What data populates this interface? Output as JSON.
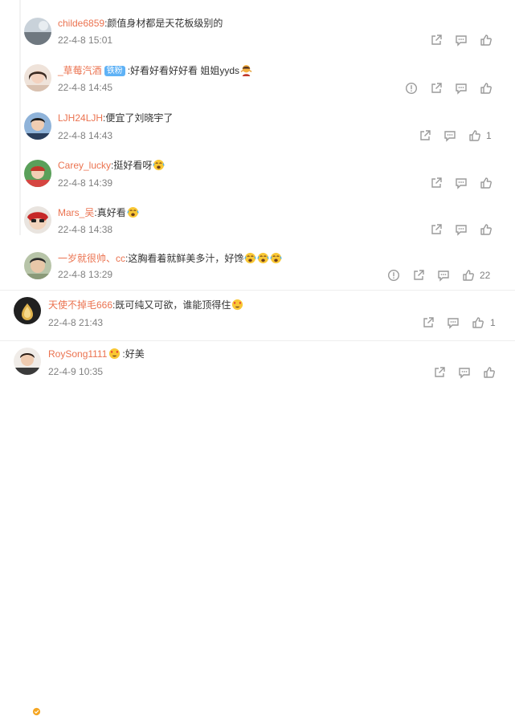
{
  "comments": [
    {
      "username": "childe6859",
      "separator": ":",
      "text": "颜值身材都是天花板级别的",
      "time": "22-4-8 15:01",
      "like_count": ""
    },
    {
      "username": "_草莓汽酒",
      "badge": "铁粉",
      "separator": ":",
      "text": "好看好看好好看 姐姐yyds",
      "time": "22-4-8 14:45",
      "like_count": ""
    },
    {
      "username": "LJH24LJH",
      "separator": ":",
      "text": "便宜了刘晓宇了",
      "time": "22-4-8 14:43",
      "like_count": "1"
    },
    {
      "username": "Carey_lucky",
      "separator": ":",
      "text": "挺好看呀",
      "time": "22-4-8 14:39",
      "like_count": ""
    },
    {
      "username": "Mars_吴",
      "separator": ":",
      "text": "真好看",
      "time": "22-4-8 14:38",
      "like_count": ""
    },
    {
      "username": "一岁就很帅、cc",
      "separator": ":",
      "text": "这胸看着就鲜美多汁，好馋",
      "time": "22-4-8 13:29",
      "like_count": "22"
    },
    {
      "username": "天使不掉毛666",
      "separator": ":",
      "text": "既可纯又可欲，谁能顶得住",
      "time": "22-4-8 21:43",
      "like_count": "1"
    },
    {
      "username": "RoySong1111",
      "separator": ":",
      "text": "好美",
      "time": "22-4-9 10:35",
      "like_count": ""
    }
  ],
  "colors": {
    "username": "#eb7350",
    "time": "#808080",
    "text": "#333333",
    "icon": "#9a9a9a",
    "fan_badge": "#5fb2f6"
  },
  "icons": [
    "report-icon",
    "share-icon",
    "comment-icon",
    "like-icon",
    "emoji-icon"
  ]
}
